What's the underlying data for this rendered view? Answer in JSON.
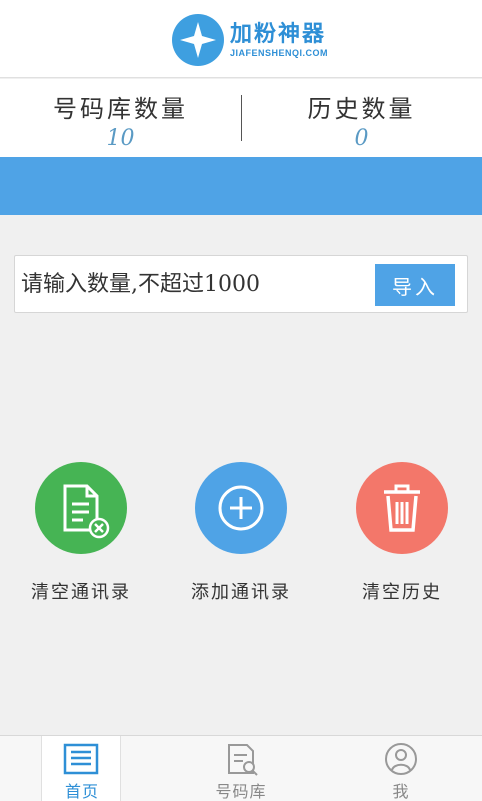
{
  "app": {
    "name_cn": "加粉神器",
    "name_en": "JIAFENSHENQI.COM",
    "brand_color": "#3e9fe0"
  },
  "stats": {
    "library_label": "号码库数量",
    "library_value": "10",
    "history_label": "历史数量",
    "history_value": "0"
  },
  "import": {
    "placeholder": "请输入数量,不超过1000",
    "button_label": "导入"
  },
  "actions": [
    {
      "label": "清空通讯录",
      "icon": "document-x-icon",
      "color": "#46b454"
    },
    {
      "label": "添加通讯录",
      "icon": "plus-circle-icon",
      "color": "#4fa3e6"
    },
    {
      "label": "清空历史",
      "icon": "trash-icon",
      "color": "#f3776a"
    }
  ],
  "tabs": [
    {
      "label": "首页",
      "icon": "home-list-icon",
      "active": true
    },
    {
      "label": "号码库",
      "icon": "document-search-icon",
      "active": false
    },
    {
      "label": "我",
      "icon": "user-icon",
      "active": false
    }
  ]
}
